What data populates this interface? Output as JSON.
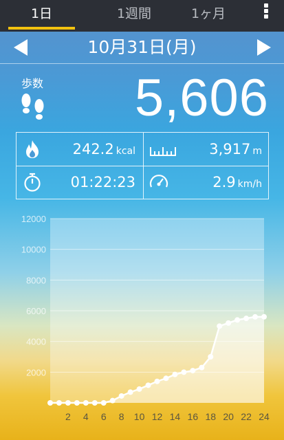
{
  "tabs": [
    {
      "label": "1日",
      "active": true
    },
    {
      "label": "1週間",
      "active": false
    },
    {
      "label": "1ヶ月",
      "active": false
    }
  ],
  "menu_icon": "more-vertical-icon",
  "date": {
    "label": "10月31日(月)",
    "prev_icon": "arrow-left-icon",
    "next_icon": "arrow-right-icon"
  },
  "steps": {
    "label": "歩数",
    "value": "5,606",
    "icon": "footprints-icon"
  },
  "stats": {
    "calories": {
      "value": "242.2",
      "unit": "kcal",
      "icon": "flame-icon"
    },
    "distance": {
      "value": "3,917",
      "unit": "m",
      "icon": "ruler-icon"
    },
    "time": {
      "value": "01:22:23",
      "icon": "stopwatch-icon"
    },
    "speed": {
      "value": "2.9",
      "unit": "km/h",
      "icon": "speedometer-icon"
    }
  },
  "colors": {
    "tabbar": "#2c2f36",
    "tab_active_underline": "#f2c20f",
    "line": "#ffffff"
  },
  "chart_data": {
    "type": "line",
    "x": [
      0,
      1,
      2,
      3,
      4,
      5,
      6,
      7,
      8,
      9,
      10,
      11,
      12,
      13,
      14,
      15,
      16,
      17,
      18,
      19,
      20,
      21,
      22,
      23,
      24
    ],
    "y": [
      0,
      0,
      0,
      0,
      0,
      0,
      0,
      150,
      450,
      700,
      900,
      1150,
      1400,
      1600,
      1850,
      2000,
      2100,
      2300,
      3000,
      5000,
      5200,
      5400,
      5500,
      5600,
      5606
    ],
    "x_ticks": [
      "2",
      "4",
      "6",
      "8",
      "10",
      "12",
      "14",
      "16",
      "18",
      "20",
      "22",
      "24"
    ],
    "y_ticks": [
      "2000",
      "4000",
      "6000",
      "8000",
      "10000",
      "12000"
    ],
    "xlim": [
      0,
      24
    ],
    "ylim": [
      0,
      12000
    ],
    "grid": true
  }
}
